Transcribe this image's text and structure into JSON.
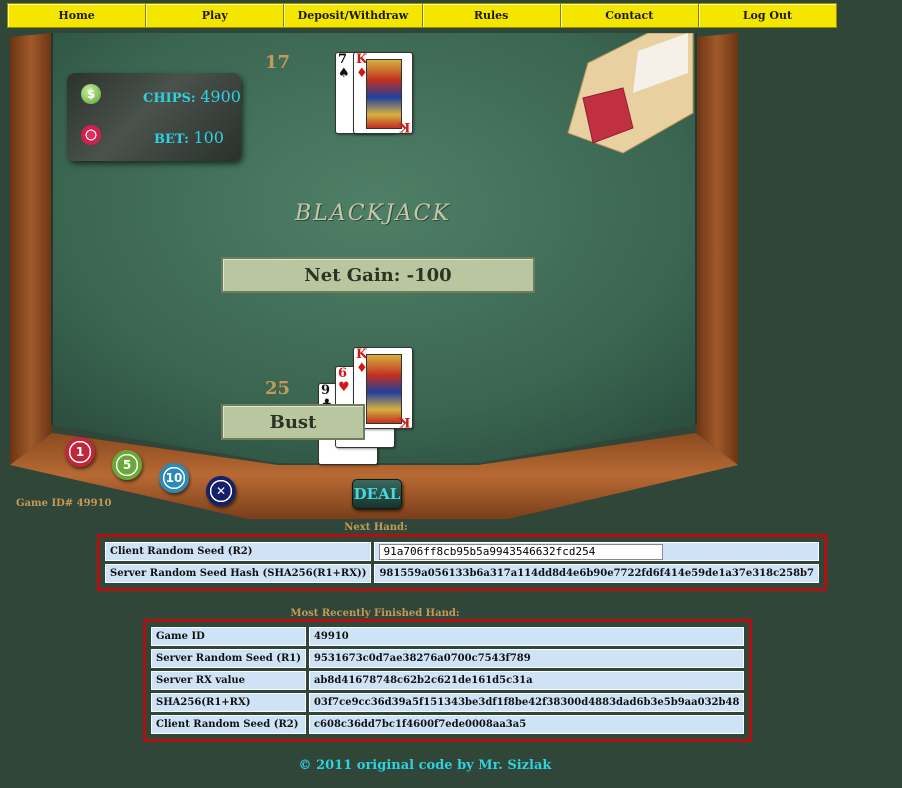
{
  "nav": {
    "items": [
      "Home",
      "Play",
      "Deposit/Withdraw",
      "Rules",
      "Contact",
      "Log Out"
    ]
  },
  "panel": {
    "chips_label": "CHIPS:",
    "chips_value": "4900",
    "bet_label": "BET:",
    "bet_value": "100",
    "dollar_symbol": "$"
  },
  "dealer": {
    "score": "17",
    "cards": [
      {
        "rank": "7",
        "suit": "♠",
        "color": "black"
      },
      {
        "rank": "K",
        "suit": "♦",
        "color": "red"
      }
    ]
  },
  "player": {
    "score": "25",
    "cards": [
      {
        "rank": "9",
        "suit": "♣",
        "color": "black"
      },
      {
        "rank": "6",
        "suit": "♥",
        "color": "red"
      },
      {
        "rank": "K",
        "suit": "♦",
        "color": "red"
      }
    ]
  },
  "logo_text": "BLACKJACK",
  "net_gain": "Net Gain: -100",
  "status": "Bust",
  "bet_chips": [
    {
      "label": "1",
      "color": "#c0283a"
    },
    {
      "label": "5",
      "color": "#6aa83a"
    },
    {
      "label": "10",
      "color": "#2a8ab8"
    },
    {
      "label": "✕",
      "color": "#14206a"
    }
  ],
  "deal_label": "DEAL",
  "game_id_label": "Game ID# 49910",
  "next_hand": {
    "title": "Next Hand:",
    "rows": [
      {
        "label": "Client Random Seed (R2)",
        "value": "91a706ff8cb95b5a9943546632fcd254"
      },
      {
        "label": "Server Random Seed Hash (SHA256(R1+RX))",
        "value": "981559a056133b6a317a114dd8d4e6b90e7722fd6f414e59de1a37e318c258b7"
      }
    ]
  },
  "finished_hand": {
    "title": "Most Recently Finished Hand:",
    "rows": [
      {
        "label": "Game ID",
        "value": "49910"
      },
      {
        "label": "Server Random Seed (R1)",
        "value": "9531673c0d7ae38276a0700c7543f789"
      },
      {
        "label": "Server RX value",
        "value": "ab8d41678748c62b2c621de161d5c31a"
      },
      {
        "label": "SHA256(R1+RX)",
        "value": "03f7ce9cc36d39a5f151343be3df1f8be42f38300d4883dad6b3e5b9aa032b48"
      },
      {
        "label": "Client Random Seed (R2)",
        "value": "c608c36dd7bc1f4600f7ede0008aa3a5"
      }
    ]
  },
  "footer": "© 2011 original code by Mr. Sizlak",
  "colors": {
    "felt": "#3d6a55",
    "wood": "#8a4a22",
    "accent": "#2fd0e0",
    "gold": "#c29a5a",
    "nav": "#f5e600"
  }
}
